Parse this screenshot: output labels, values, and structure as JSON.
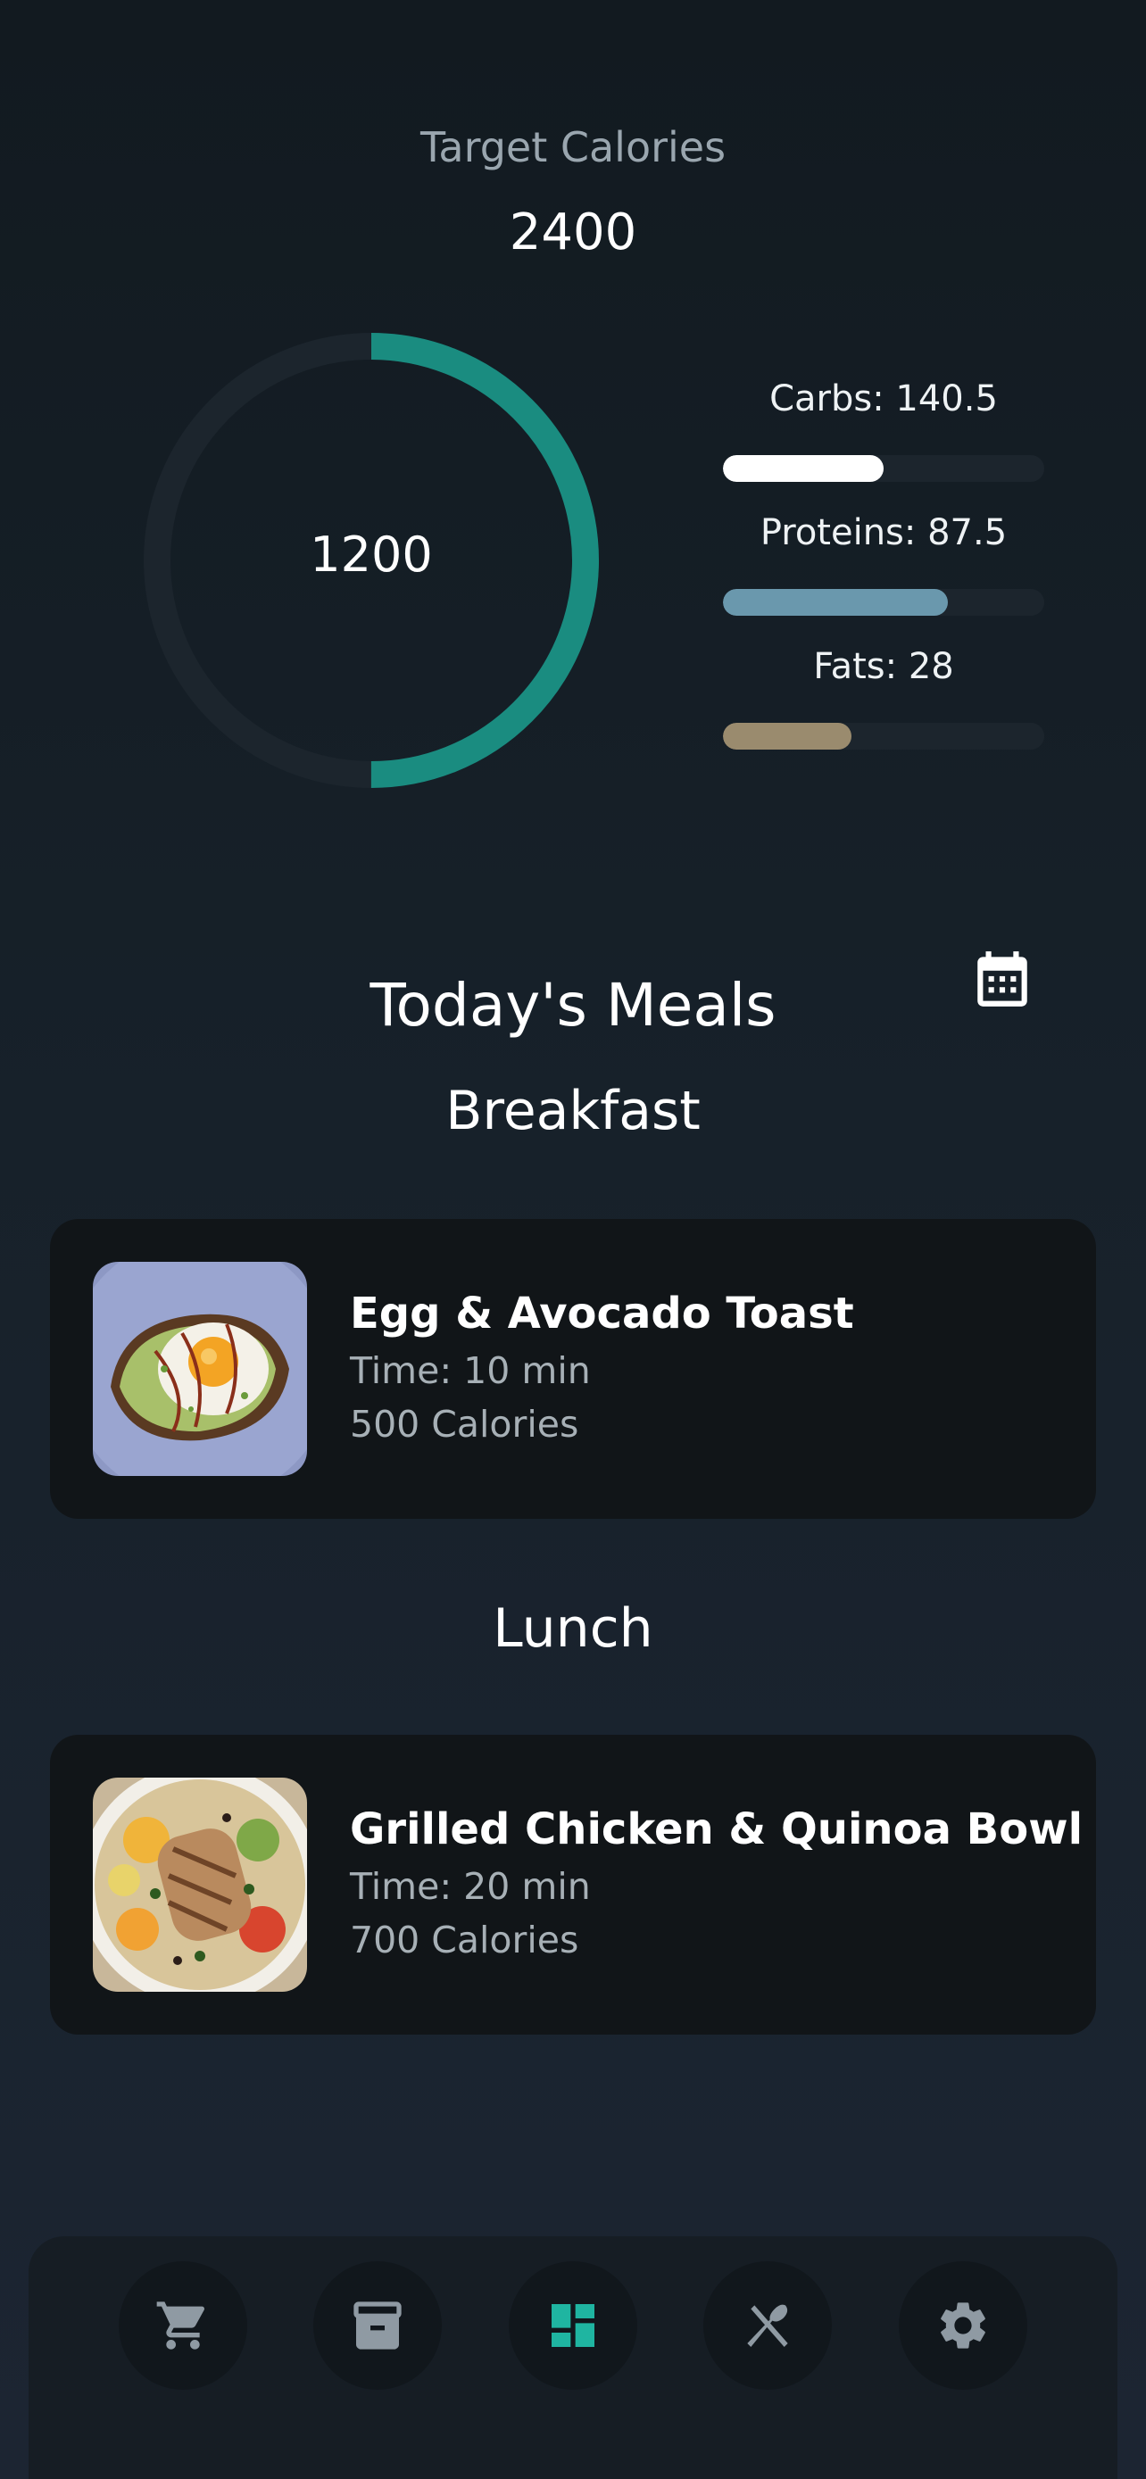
{
  "summary": {
    "target_label": "Target Calories",
    "target_value": "2400",
    "consumed_value": "1200",
    "consumed_fraction": 0.5
  },
  "macros": [
    {
      "label": "Carbs: 140.5",
      "fill_fraction": 0.5,
      "color": "#ffffff"
    },
    {
      "label": "Proteins: 87.5",
      "fill_fraction": 0.7,
      "color": "#6a98ad"
    },
    {
      "label": "Fats: 28",
      "fill_fraction": 0.4,
      "color": "#9a8b6e"
    }
  ],
  "meals_section": {
    "title": "Today's Meals",
    "calendar_icon": "calendar-icon",
    "groups": [
      {
        "title": "Breakfast",
        "meal": {
          "name": "Egg & Avocado Toast",
          "time": "Time: 10 min",
          "calories": "500 Calories",
          "image": "avocado-toast-photo"
        }
      },
      {
        "title": "Lunch",
        "meal": {
          "name": "Grilled Chicken & Quinoa Bowl",
          "time": "Time: 20 min",
          "calories": "700 Calories",
          "image": "chicken-quinoa-bowl-photo"
        }
      }
    ]
  },
  "nav": {
    "items": [
      {
        "icon": "cart-icon",
        "active": false
      },
      {
        "icon": "archive-icon",
        "active": false
      },
      {
        "icon": "dashboard-icon",
        "active": true
      },
      {
        "icon": "utensils-icon",
        "active": false
      },
      {
        "icon": "gear-icon",
        "active": false
      }
    ],
    "active_color": "#1fb5a1",
    "inactive_color": "#8f9aa3"
  },
  "colors": {
    "accent": "#1a8c80",
    "ring_track": "#1c252d",
    "card_bg": "#111518"
  }
}
